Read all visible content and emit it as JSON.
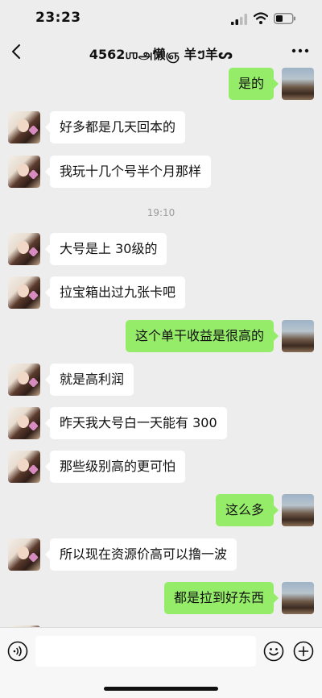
{
  "status_bar": {
    "time": "23:23"
  },
  "header": {
    "title": "4562ஶஅ懒ஞ 羊ៗ羊ᔕ"
  },
  "chat": {
    "timestamp": "19:10",
    "messages": [
      {
        "from": "me",
        "text": "是的"
      },
      {
        "from": "other",
        "text": "好多都是几天回本的"
      },
      {
        "from": "other",
        "text": "我玩十几个号半个月那样"
      },
      {
        "from": "other",
        "text": "大号是上 30级的"
      },
      {
        "from": "other",
        "text": "拉宝箱出过九张卡吧"
      },
      {
        "from": "me",
        "text": "这个单干收益是很高的"
      },
      {
        "from": "other",
        "text": "就是高利润"
      },
      {
        "from": "other",
        "text": "昨天我大号白一天能有 300"
      },
      {
        "from": "other",
        "text": "那些级别高的更可怕"
      },
      {
        "from": "me",
        "text": "这么多"
      },
      {
        "from": "other",
        "text": "所以现在资源价高可以撸一波"
      },
      {
        "from": "me",
        "text": "都是拉到好东西"
      }
    ]
  },
  "input_bar": {
    "placeholder": "",
    "value": ""
  },
  "colors": {
    "background": "#ededed",
    "outgoing_bubble": "#95ec69",
    "incoming_bubble": "#ffffff"
  },
  "icons": [
    "signal-icon",
    "wifi-icon",
    "battery-icon",
    "back-chevron-icon",
    "more-dots-icon",
    "voice-icon",
    "emoji-icon",
    "plus-icon"
  ]
}
